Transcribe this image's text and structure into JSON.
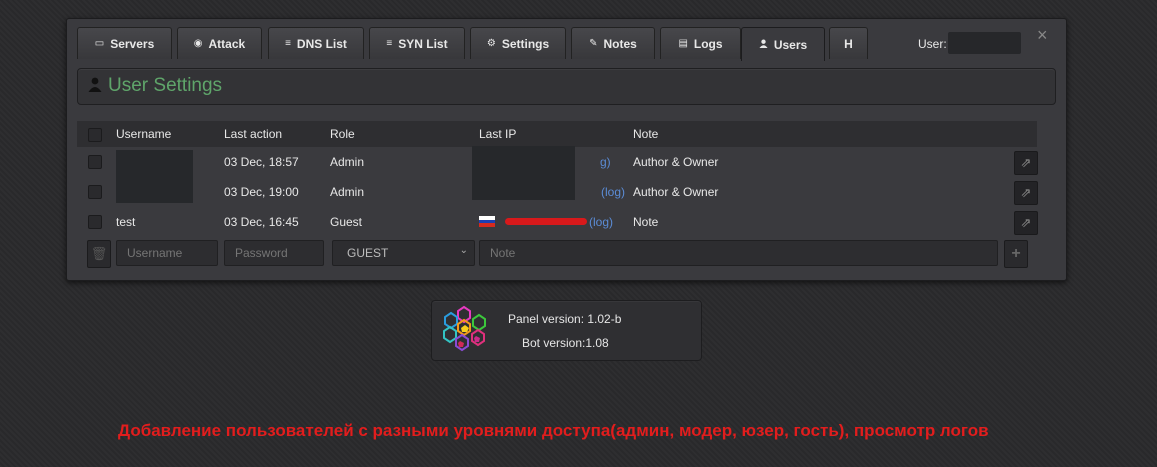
{
  "tabs": [
    {
      "label": "Servers",
      "icon": "server-icon",
      "glyph": "🖴"
    },
    {
      "label": "Attack",
      "icon": "dashboard-icon",
      "glyph": "◉"
    },
    {
      "label": "DNS List",
      "icon": "list-icon",
      "glyph": "≡"
    },
    {
      "label": "SYN List",
      "icon": "list-icon",
      "glyph": "≡"
    },
    {
      "label": "Settings",
      "icon": "cogs-icon",
      "glyph": "⚙"
    },
    {
      "label": "Notes",
      "icon": "edit-icon",
      "glyph": "✎"
    },
    {
      "label": "Logs",
      "icon": "file-icon",
      "glyph": "▤"
    },
    {
      "label": "Users",
      "icon": "user-icon",
      "glyph": "●"
    },
    {
      "label": "H"
    }
  ],
  "active_tab": "Users",
  "header": {
    "user_label": "User:",
    "close": "×"
  },
  "section": {
    "title": "User Settings"
  },
  "table": {
    "columns": [
      "Username",
      "Last action",
      "Role",
      "Last IP",
      "Note"
    ],
    "rows": [
      {
        "username": "",
        "last_action": "03 Dec, 18:57",
        "role": "Admin",
        "ip_suffix": "g)",
        "note": "Author & Owner"
      },
      {
        "username": "",
        "last_action": "03 Dec, 19:00",
        "role": "Admin",
        "ip_suffix": "(log)",
        "note": "Author & Owner"
      },
      {
        "username": "test",
        "last_action": "03 Dec, 16:45",
        "role": "Guest",
        "ip_suffix": "(log)",
        "note": "Note"
      }
    ]
  },
  "add_form": {
    "username_placeholder": "Username",
    "password_placeholder": "Password",
    "role_value": "GUEST",
    "note_placeholder": "Note"
  },
  "version": {
    "panel": "Panel version: 1.02-b",
    "bot": "Bot version:1.08"
  },
  "caption": "Добавление пользователей с разными уровнями доступа(админ, модер, юзер, гость), просмотр логов",
  "colors": {
    "title_green": "#5fa56a",
    "caption_red": "#e21d1d",
    "link_blue": "#5b8cd6"
  }
}
